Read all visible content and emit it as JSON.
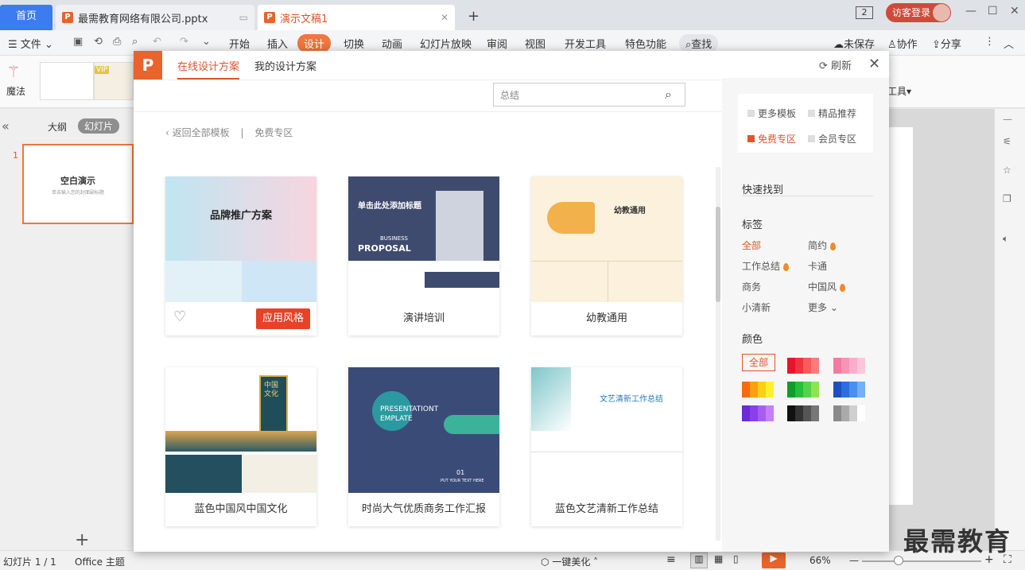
{
  "tabs": {
    "home": "首页",
    "doc1": "最需教育网络有限公司.pptx",
    "doc2": "演示文稿1",
    "add": "+",
    "page_badge": "2",
    "login": "访客登录"
  },
  "menu": {
    "file": "文件",
    "items": [
      "开始",
      "插入",
      "设计",
      "切换",
      "动画",
      "幻灯片放映",
      "审阅",
      "视图",
      "开发工具",
      "特色功能"
    ],
    "search": "查找",
    "unsaved": "未保存",
    "collab": "协作",
    "share": "分享"
  },
  "ribbon": {
    "magic": "魔法",
    "vip": "VIP",
    "tools": "工具"
  },
  "leftpanel": {
    "outline": "大纲",
    "slides": "幻灯片",
    "slide_num": "1",
    "slide_title": "空白演示",
    "slide_sub": "单击输入您的封面副标题"
  },
  "dialog": {
    "logo": "P",
    "tab_online": "在线设计方案",
    "tab_mine": "我的设计方案",
    "refresh": "刷新",
    "search_placeholder": "总结",
    "back": "返回全部模板",
    "crumb": "免费专区",
    "apply": "应用风格",
    "cards": [
      {
        "label": "",
        "thumb_title": "品牌推广方案"
      },
      {
        "label": "演讲培训",
        "thumb_title": "单击此处添加标题",
        "thumb_sub": "BUSINESS",
        "thumb_big": "PROPOSAL"
      },
      {
        "label": "幼教通用",
        "thumb_title": "幼教通用"
      },
      {
        "label": "蓝色中国风中国文化",
        "thumb_title": "中国文化"
      },
      {
        "label": "时尚大气优质商务工作汇报",
        "thumb_title": "PRESENTATIONT",
        "thumb_sub": "EMPLATE",
        "thumb_num": "01",
        "thumb_put": "PUT YOUR TEXT HERE"
      },
      {
        "label": "蓝色文艺清新工作总结",
        "thumb_title": "文艺清新工作总结"
      }
    ],
    "sidebar": {
      "more_templates": "更多模板",
      "premium": "精品推荐",
      "free": "免费专区",
      "member": "会员专区",
      "quick_find": "快速找到",
      "tags_title": "标签",
      "tags": [
        "全部",
        "简约",
        "工作总结",
        "卡通",
        "商务",
        "中国风",
        "小清新",
        "更多"
      ],
      "colors_title": "颜色",
      "colors_all": "全部",
      "color_swatches": [
        [
          "#e8142a",
          "#f0343f",
          "#f95a5a",
          "#ff7b7b"
        ],
        [
          "#f47aa2",
          "#f894b5",
          "#fbaecb",
          "#fdc6db"
        ],
        [
          "#f66c0c",
          "#f9a10f",
          "#fbd014",
          "#fff02a"
        ],
        [
          "#0f9c2a",
          "#24c03b",
          "#52d34a",
          "#8ee352"
        ],
        [
          "#1e4fc2",
          "#2e6de0",
          "#4a8ef0",
          "#72b0f7"
        ],
        [
          "#6b2bd6",
          "#8a3fe8",
          "#a75ef0",
          "#c77ff7"
        ],
        [
          "#111111",
          "#333333",
          "#555555",
          "#777777"
        ],
        [
          "#8a8a8a",
          "#aaaaaa",
          "#cfcfcf",
          "#ffffff"
        ]
      ]
    }
  },
  "statusbar": {
    "slide_info": "幻灯片 1 / 1",
    "theme": "Office 主题",
    "beautify": "一键美化",
    "zoom": "66%"
  },
  "watermark": "最需教育"
}
